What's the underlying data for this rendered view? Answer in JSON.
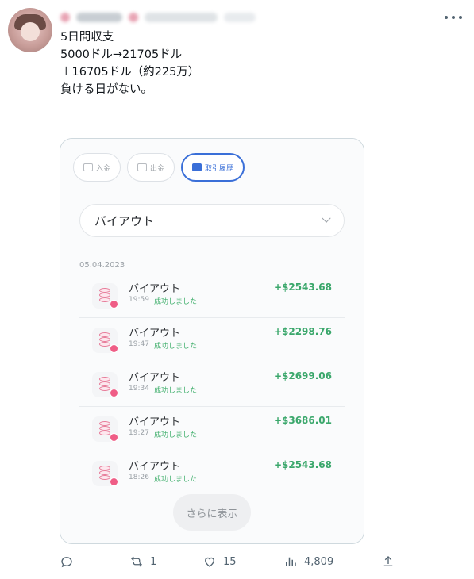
{
  "post": {
    "text_lines": [
      "5日間収支",
      "",
      "5000ドル→21705ドル",
      "＋16705ドル（約225万）",
      "",
      "負ける日がない。"
    ]
  },
  "media": {
    "tabs": [
      {
        "label": "入金",
        "active": false
      },
      {
        "label": "出金",
        "active": false
      },
      {
        "label": "取引履歴",
        "active": true
      }
    ],
    "filter": {
      "selected": "バイアウト"
    },
    "date": "05.04.2023",
    "rows": [
      {
        "title": "バイアウト",
        "time": "19:59",
        "status": "成功しました",
        "amount": "+$2543.68"
      },
      {
        "title": "バイアウト",
        "time": "19:47",
        "status": "成功しました",
        "amount": "+$2298.76"
      },
      {
        "title": "バイアウト",
        "time": "19:34",
        "status": "成功しました",
        "amount": "+$2699.06"
      },
      {
        "title": "バイアウト",
        "time": "19:27",
        "status": "成功しました",
        "amount": "+$3686.01"
      },
      {
        "title": "バイアウト",
        "time": "18:26",
        "status": "成功しました",
        "amount": "+$2543.68"
      }
    ],
    "show_more_label": "さらに表示",
    "colors": {
      "accent": "#3a6fd8",
      "positive": "#3aa76b",
      "status": "#43b06e",
      "coin": "#ef5d86"
    }
  },
  "actions": {
    "reply": {
      "icon": "reply-icon",
      "count": ""
    },
    "repost": {
      "icon": "repost-icon",
      "count": "1"
    },
    "like": {
      "icon": "heart-icon",
      "count": "15"
    },
    "views": {
      "icon": "views-icon",
      "count": "4,809"
    },
    "share": {
      "icon": "share-icon"
    }
  },
  "colors": {
    "text": "#0f1419",
    "muted": "#536471",
    "border": "#cfd9de"
  }
}
